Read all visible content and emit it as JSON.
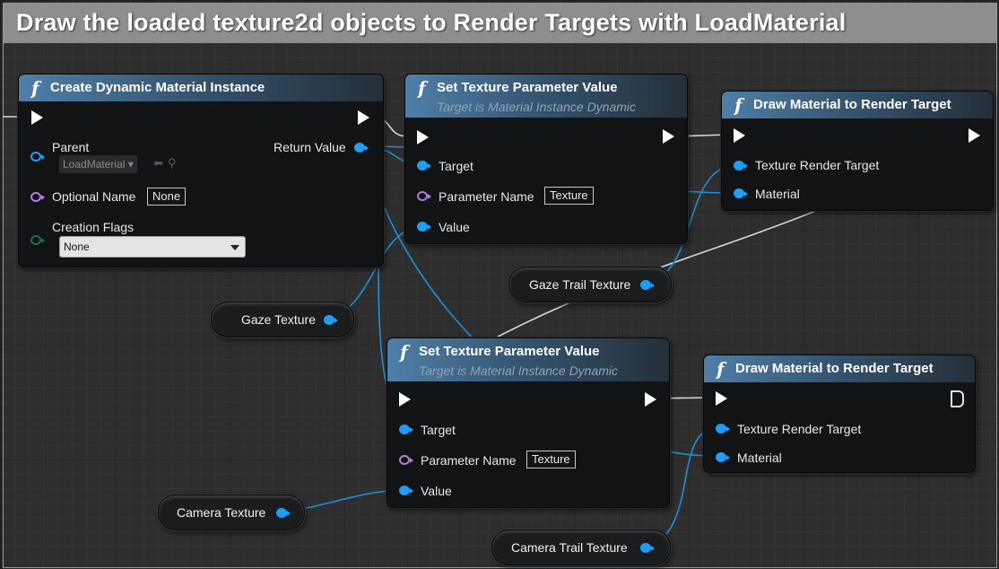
{
  "comment": {
    "title": "Draw the loaded texture2d objects to Render Targets with LoadMaterial"
  },
  "nodes": {
    "create_dmi": {
      "title": "Create Dynamic Material Instance",
      "parent_label": "Parent",
      "parent_asset": "LoadMaterial",
      "return_label": "Return Value",
      "optional_name_label": "Optional Name",
      "optional_name_value": "None",
      "creation_flags_label": "Creation Flags",
      "creation_flags_value": "None"
    },
    "set_tex_1": {
      "title": "Set Texture Parameter Value",
      "subtitle": "Target is Material Instance Dynamic",
      "target_label": "Target",
      "param_name_label": "Parameter Name",
      "param_name_value": "Texture",
      "value_label": "Value"
    },
    "set_tex_2": {
      "title": "Set Texture Parameter Value",
      "subtitle": "Target is Material Instance Dynamic",
      "target_label": "Target",
      "param_name_label": "Parameter Name",
      "param_name_value": "Texture",
      "value_label": "Value"
    },
    "draw_mat_1": {
      "title": "Draw Material to Render Target",
      "texture_rt_label": "Texture Render Target",
      "material_label": "Material"
    },
    "draw_mat_2": {
      "title": "Draw Material to Render Target",
      "texture_rt_label": "Texture Render Target",
      "material_label": "Material"
    }
  },
  "variables": {
    "gaze_texture": "Gaze Texture",
    "gaze_trail_texture": "Gaze Trail Texture",
    "camera_texture": "Camera Texture",
    "camera_trail_texture": "Camera Trail Texture"
  },
  "colors": {
    "exec_pin": "#ffffff",
    "object_pin": "#1e9ef5",
    "name_pin": "#b07ee0",
    "enum_pin": "#1e6b58",
    "header_start": "#4f7fa8",
    "comment_header": "#8e8e8e"
  }
}
